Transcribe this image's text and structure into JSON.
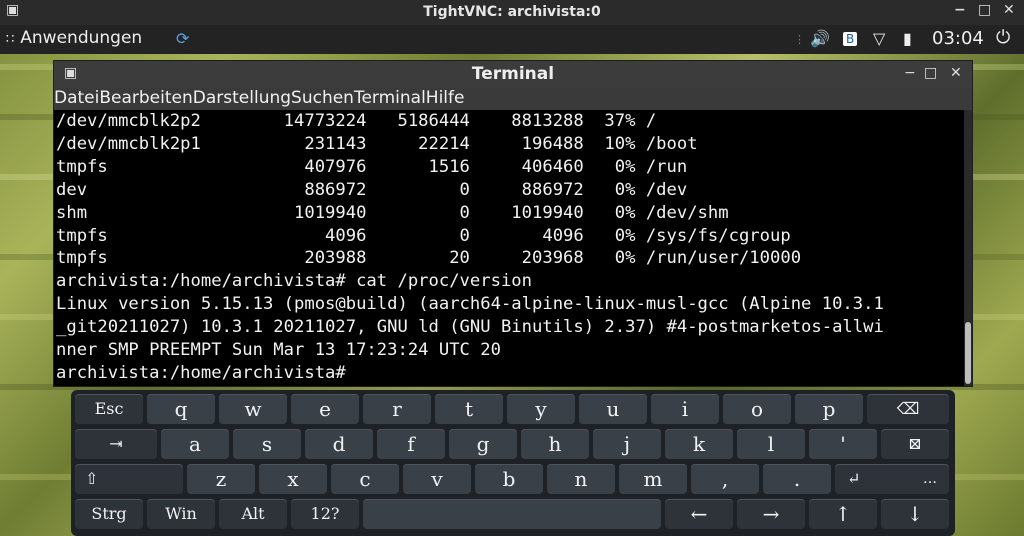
{
  "vnc": {
    "title": "TightVNC: archivista:0",
    "menu_icon": "vnc-menu-icon",
    "minimize": "−",
    "maximize": "□",
    "close": "✕"
  },
  "panel": {
    "apps_label": "Anwendungen",
    "clock": "03:04",
    "tray_icons": [
      "speaker-icon",
      "bluetooth-icon",
      "wifi-icon",
      "battery-icon",
      "power-icon"
    ]
  },
  "terminal": {
    "title": "Terminal",
    "menu": [
      "Datei",
      "Bearbeiten",
      "Darstellung",
      "Suchen",
      "Terminal",
      "Hilfe"
    ],
    "lines": [
      "/dev/mmcblk2p2        14773224   5186444    8813288  37% /",
      "/dev/mmcblk2p1          231143     22214     196488  10% /boot",
      "tmpfs                   407976      1516     406460   0% /run",
      "dev                     886972         0     886972   0% /dev",
      "shm                    1019940         0    1019940   0% /dev/shm",
      "tmpfs                     4096         0       4096   0% /sys/fs/cgroup",
      "tmpfs                   203988        20     203968   0% /run/user/10000",
      "archivista:/home/archivista# cat /proc/version",
      "Linux version 5.15.13 (pmos@build) (aarch64-alpine-linux-musl-gcc (Alpine 10.3.1",
      "_git20211027) 10.3.1 20211027, GNU ld (GNU Binutils) 2.37) #4-postmarketos-allwi",
      "nner SMP PREEMPT Sun Mar 13 17:23:24 UTC 20",
      "archivista:/home/archivista#"
    ]
  },
  "keyboard": {
    "rows": [
      [
        "Esc",
        "q",
        "w",
        "e",
        "r",
        "t",
        "y",
        "u",
        "i",
        "o",
        "p",
        "⌫"
      ],
      [
        "⇥",
        "a",
        "s",
        "d",
        "f",
        "g",
        "h",
        "j",
        "k",
        "l",
        "'",
        "⊠"
      ],
      [
        "⇧",
        "z",
        "x",
        "c",
        "v",
        "b",
        "n",
        "m",
        ",",
        ".",
        "↵"
      ],
      [
        "Strg",
        "Win",
        "Alt",
        "12?",
        "",
        "←",
        "→",
        "↑",
        "↓"
      ]
    ]
  }
}
